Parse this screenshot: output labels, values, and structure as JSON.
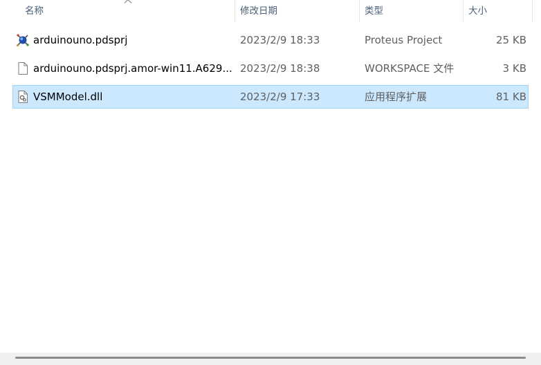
{
  "columns": {
    "name": "名称",
    "date_modified": "修改日期",
    "type": "类型",
    "size": "大小"
  },
  "sort": {
    "column": "name",
    "direction": "ascending",
    "icon": "chevron-up-icon"
  },
  "files": [
    {
      "name": "arduinouno.pdsprj",
      "date_modified": "2023/2/9 18:33",
      "type": "Proteus Project",
      "size": "25 KB",
      "icon": "proteus-project-icon",
      "selected": false
    },
    {
      "name": "arduinouno.pdsprj.amor-win11.A629...",
      "date_modified": "2023/2/9 18:38",
      "type": "WORKSPACE 文件",
      "size": "3 KB",
      "icon": "generic-file-icon",
      "selected": false
    },
    {
      "name": "VSMModel.dll",
      "date_modified": "2023/2/9 17:33",
      "type": "应用程序扩展",
      "size": "81 KB",
      "icon": "dll-file-icon",
      "selected": true
    }
  ],
  "colors": {
    "selection_background": "#cce8ff",
    "selection_border": "#99d1ff",
    "header_text": "#4c607a",
    "meta_text": "#5f5f5f"
  }
}
